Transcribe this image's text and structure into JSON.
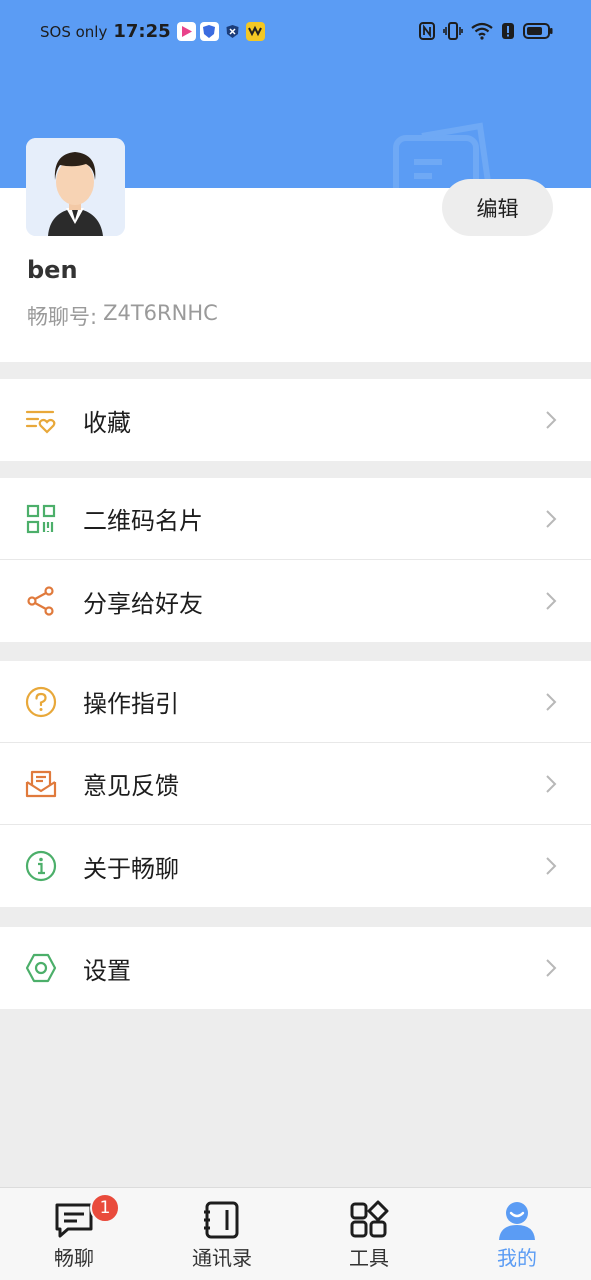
{
  "status_bar": {
    "sos": "SOS only",
    "time": "17:25",
    "app_icons": [
      "video-app-icon",
      "shield-app-icon",
      "security-app-icon",
      "game-app-icon"
    ],
    "right_icons": [
      "nfc-icon",
      "vibrate-icon",
      "wifi-icon",
      "alert-icon",
      "battery-icon"
    ]
  },
  "profile": {
    "name": "ben",
    "id_label": "畅聊号:",
    "id_value": "Z4T6RNHC",
    "edit_label": "编辑"
  },
  "menu_groups": [
    [
      {
        "key": "favorites",
        "icon": "favorites-heart-icon",
        "label": "收藏",
        "color": "#e8a83a"
      }
    ],
    [
      {
        "key": "qrcode",
        "icon": "qrcode-icon",
        "label": "二维码名片",
        "color": "#4caf6a"
      },
      {
        "key": "share",
        "icon": "share-icon",
        "label": "分享给好友",
        "color": "#e07a3c"
      }
    ],
    [
      {
        "key": "guide",
        "icon": "help-circle-icon",
        "label": "操作指引",
        "color": "#e8a83a"
      },
      {
        "key": "feedback",
        "icon": "feedback-mail-icon",
        "label": "意见反馈",
        "color": "#e07a3c"
      },
      {
        "key": "about",
        "icon": "info-circle-icon",
        "label": "关于畅聊",
        "color": "#4caf6a"
      }
    ],
    [
      {
        "key": "settings",
        "icon": "settings-hexagon-icon",
        "label": "设置",
        "color": "#4caf6a"
      }
    ]
  ],
  "tabbar": {
    "tabs": [
      {
        "key": "chat",
        "label": "畅聊",
        "icon": "chat-bubble-icon",
        "badge": "1",
        "active": false
      },
      {
        "key": "contacts",
        "label": "通讯录",
        "icon": "contacts-book-icon",
        "active": false
      },
      {
        "key": "tools",
        "label": "工具",
        "icon": "tools-grid-icon",
        "active": false
      },
      {
        "key": "me",
        "label": "我的",
        "icon": "profile-person-icon",
        "active": true
      }
    ]
  },
  "colors": {
    "header_blue": "#5b9cf4",
    "badge_red": "#e94b3c",
    "active_tab": "#5b9cf4"
  }
}
